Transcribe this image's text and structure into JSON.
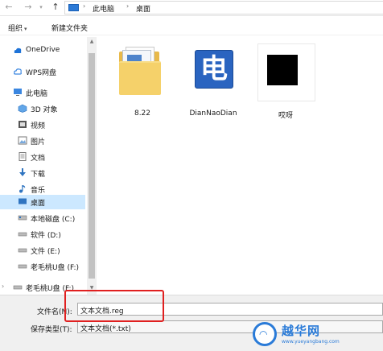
{
  "breadcrumb": [
    "此电脑",
    "桌面"
  ],
  "toolbar": {
    "organize": "组织",
    "new_folder": "新建文件夹"
  },
  "nav": [
    {
      "label": "OneDrive",
      "icon": "cloud-icon"
    },
    {
      "label": "WPS网盘",
      "icon": "cloud-icon"
    },
    {
      "label": "此电脑",
      "icon": "computer-icon"
    },
    {
      "label": "3D 对象",
      "icon": "cube-icon"
    },
    {
      "label": "视频",
      "icon": "video-icon"
    },
    {
      "label": "图片",
      "icon": "picture-icon"
    },
    {
      "label": "文档",
      "icon": "document-icon"
    },
    {
      "label": "下载",
      "icon": "download-icon"
    },
    {
      "label": "音乐",
      "icon": "music-icon"
    },
    {
      "label": "桌面",
      "icon": "desktop-icon",
      "selected": true
    },
    {
      "label": "本地磁盘 (C:)",
      "icon": "drive-icon"
    },
    {
      "label": "软件 (D:)",
      "icon": "drive-icon"
    },
    {
      "label": "文件 (E:)",
      "icon": "drive-icon"
    },
    {
      "label": "老毛桃U盘 (F:)",
      "icon": "usb-drive-icon"
    },
    {
      "label": "老毛桃U盘 (F:)",
      "icon": "usb-drive-icon"
    }
  ],
  "files": [
    {
      "name": "8.22",
      "type": "folder"
    },
    {
      "name": "DianNaoDian",
      "type": "app"
    },
    {
      "name": "哎呀",
      "type": "image"
    }
  ],
  "app_icon_char": "电",
  "form": {
    "filename_label": "文件名(N):",
    "filename_value": "文本文档.reg",
    "filetype_label": "保存类型(T):",
    "filetype_value": "文本文档(*.txt)"
  },
  "watermark": {
    "text": "越华网",
    "url": "www.yueyangbang.com"
  },
  "colors": {
    "selected": "#cce8ff",
    "highlight": "#e02020",
    "accent": "#2a7bd8"
  }
}
